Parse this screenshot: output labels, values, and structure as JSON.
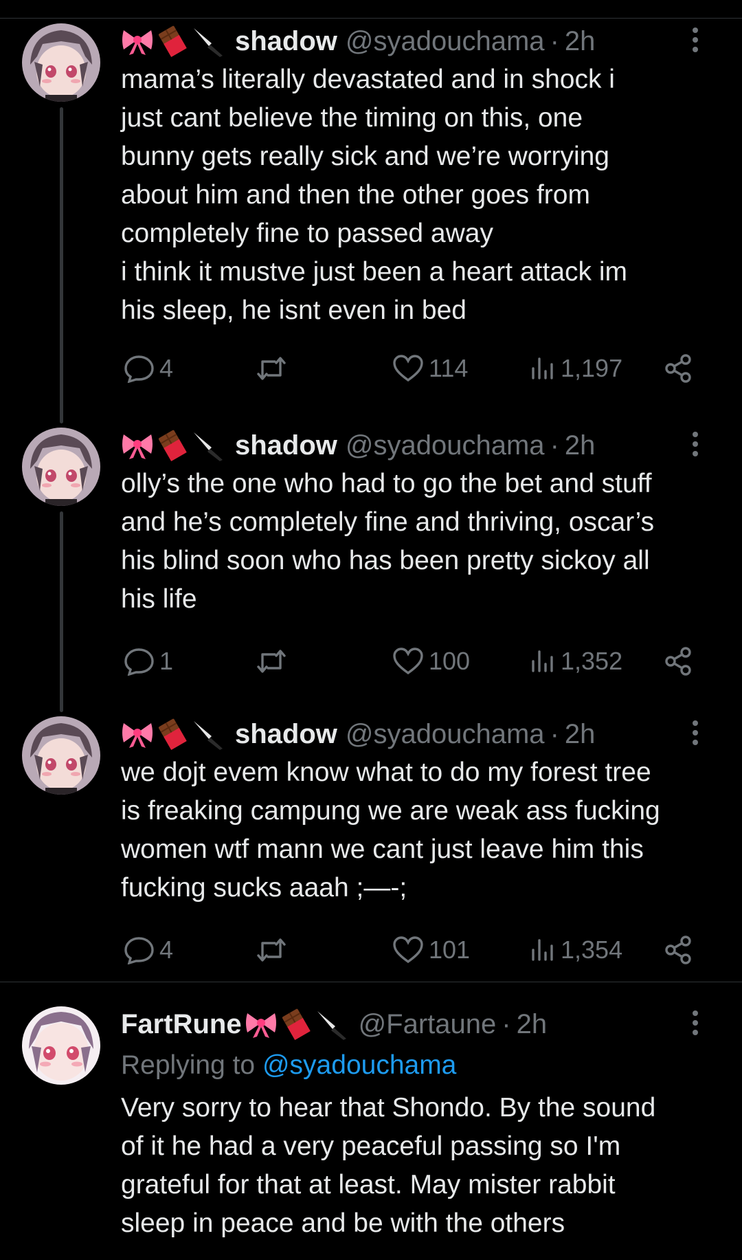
{
  "colors": {
    "background": "#000000",
    "text": "#e7e9ea",
    "muted": "#71767b",
    "link": "#1d9bf0",
    "divider": "#2f3336"
  },
  "tweets": [
    {
      "display_name": "shadow",
      "name_emojis": [
        "ribbon",
        "chocolate-bar",
        "knife"
      ],
      "handle": "@syadouchama",
      "separator": "·",
      "time": "2h",
      "lines": [
        "mama’s literally devastated and in shock i",
        "just cant believe the timing on this, one",
        "bunny gets really sick and we’re worrying",
        "about him and then the other goes from",
        "completely fine to passed away",
        "i think it mustve just been a heart attack im",
        "his sleep, he isnt even in bed"
      ],
      "replies": "4",
      "likes": "114",
      "views": "1,197"
    },
    {
      "display_name": "shadow",
      "name_emojis": [
        "ribbon",
        "chocolate-bar",
        "knife"
      ],
      "handle": "@syadouchama",
      "separator": "·",
      "time": "2h",
      "lines": [
        "olly’s the one who had to go the bet and stuff",
        "and he’s completely fine and thriving, oscar’s",
        "his blind soon who has been pretty sickoy all",
        "his life"
      ],
      "replies": "1",
      "likes": "100",
      "views": "1,352"
    },
    {
      "display_name": "shadow",
      "name_emojis": [
        "ribbon",
        "chocolate-bar",
        "knife"
      ],
      "handle": "@syadouchama",
      "separator": "·",
      "time": "2h",
      "lines": [
        "we dojt evem know what to do my forest tree",
        "is freaking campung we are weak ass fucking",
        "women wtf mann we cant just leave him this",
        "fucking sucks aaah ;—-;"
      ],
      "replies": "4",
      "likes": "101",
      "views": "1,354"
    }
  ],
  "reply_tweet": {
    "display_name": "FartRune",
    "name_emojis": [
      "ribbon",
      "chocolate-bar",
      "knife"
    ],
    "handle": "@Fartaune",
    "separator": "·",
    "time": "2h",
    "replying_to_label": "Replying to",
    "replying_to_handle": "@syadouchama",
    "lines": [
      "Very sorry to hear that Shondo. By the sound",
      "of it he had a very peaceful passing so I'm",
      "grateful for that at least. May mister rabbit",
      "sleep in peace and be with the others"
    ]
  }
}
